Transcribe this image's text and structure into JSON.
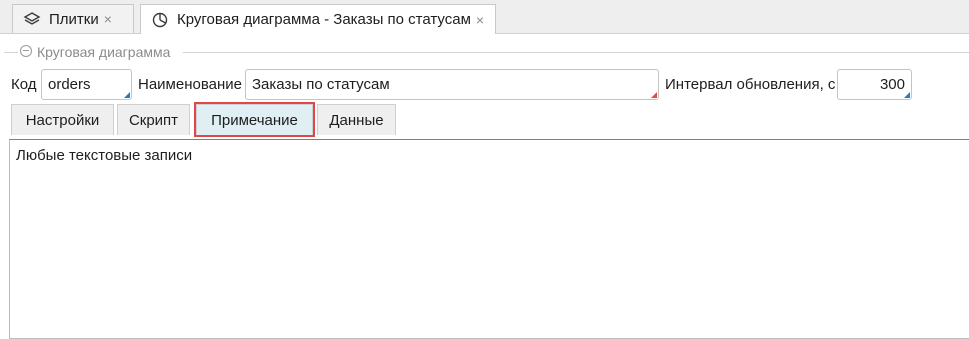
{
  "doc_tabs": [
    {
      "label": "Плитки",
      "icon": "layers-icon"
    },
    {
      "label": "Круговая диаграмма - Заказы по статусам",
      "icon": "pie-chart-icon"
    }
  ],
  "close_glyph": "×",
  "group": {
    "title": "Круговая диаграмма",
    "icon": "collapse-icon"
  },
  "form": {
    "code_label": "Код",
    "code_value": "orders",
    "name_label": "Наименование",
    "name_value": "Заказы по статусам",
    "interval_label": "Интервал обновления, с",
    "interval_value": "300"
  },
  "inner_tabs": [
    "Настройки",
    "Скрипт",
    "Примечание",
    "Данные"
  ],
  "active_inner_tab": "Примечание",
  "note_text": "Любые текстовые записи",
  "colors": {
    "accent_blue": "#1f7dc2",
    "highlight_red": "#e0474a",
    "active_tab_bg": "#dfeff3"
  }
}
